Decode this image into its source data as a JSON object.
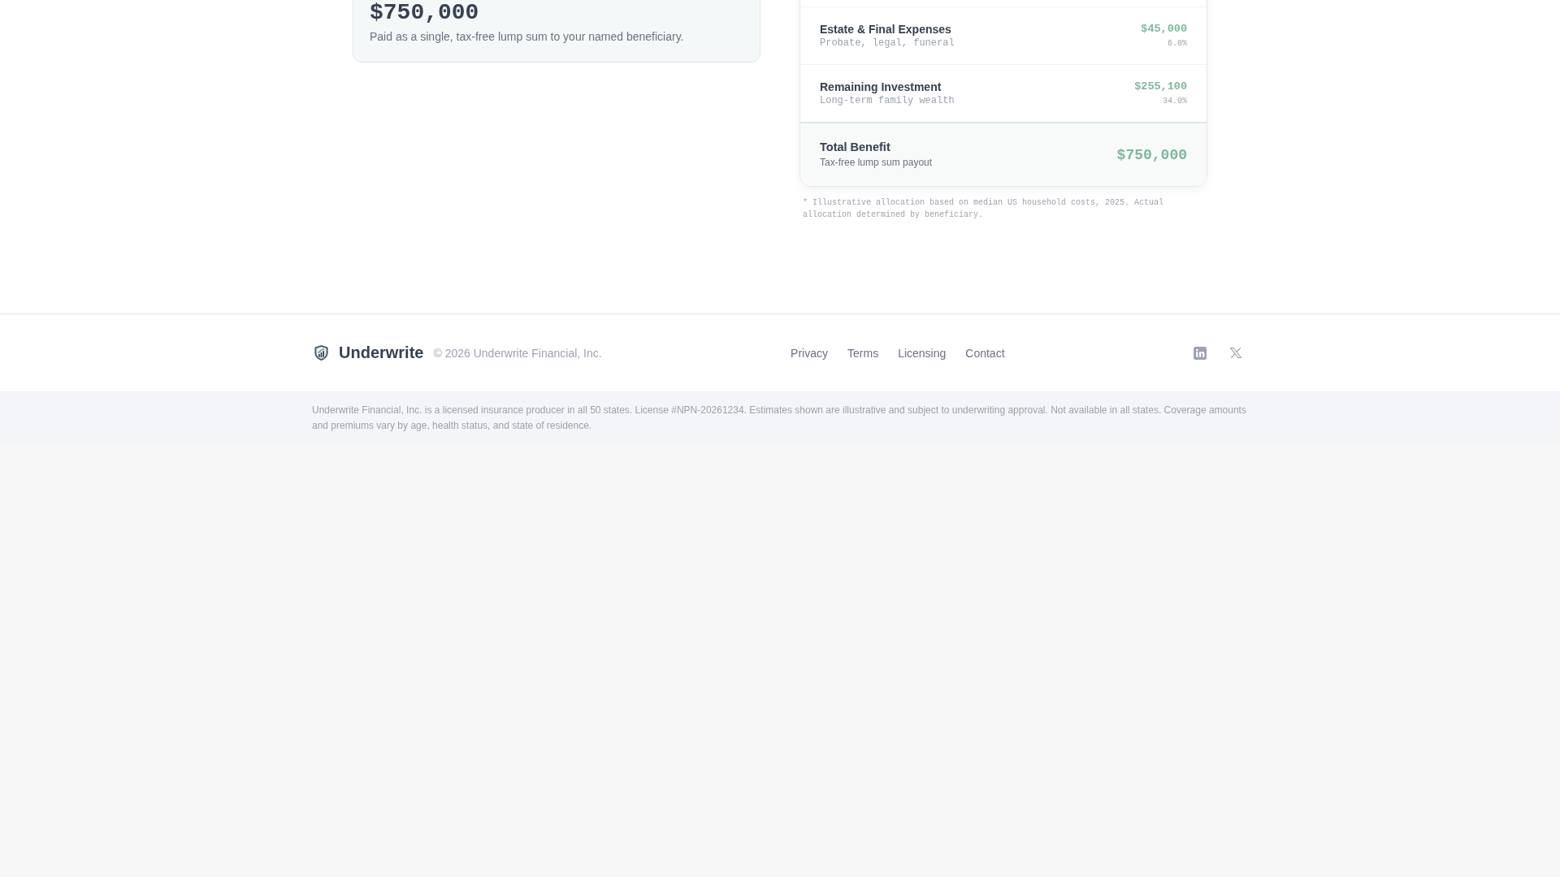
{
  "coverage_card": {
    "amount": "$750,000",
    "description": "Paid as a single, tax-free lump sum to your named beneficiary."
  },
  "allocation": {
    "rows": [
      {
        "label": "Estate & Final Expenses",
        "note": "Probate, legal, funeral",
        "amount": "$45,000",
        "share": "6.0%"
      },
      {
        "label": "Remaining Investment",
        "note": "Long-term family wealth",
        "amount": "$255,100",
        "share": "34.0%"
      }
    ],
    "total": {
      "label": "Total Benefit",
      "note": "Tax-free lump sum payout",
      "amount": "$750,000"
    },
    "footnote": "* Illustrative allocation based on median US household costs, 2025. Actual allocation determined by beneficiary."
  },
  "footer": {
    "brand": "Underwrite",
    "copyright": "© 2026 Underwrite Financial, Inc.",
    "links": [
      "Privacy",
      "Terms",
      "Licensing",
      "Contact"
    ],
    "social": [
      {
        "kind": "linkedin"
      },
      {
        "kind": "x"
      }
    ]
  },
  "disclaimer": "Underwrite Financial, Inc. is a licensed insurance producer in all 50 states. License #NPN-20261234. Estimates shown are illustrative and subject to underwriting approval. Not available in all states. Coverage amounts and premiums vary by age, health status, and state of residence."
}
